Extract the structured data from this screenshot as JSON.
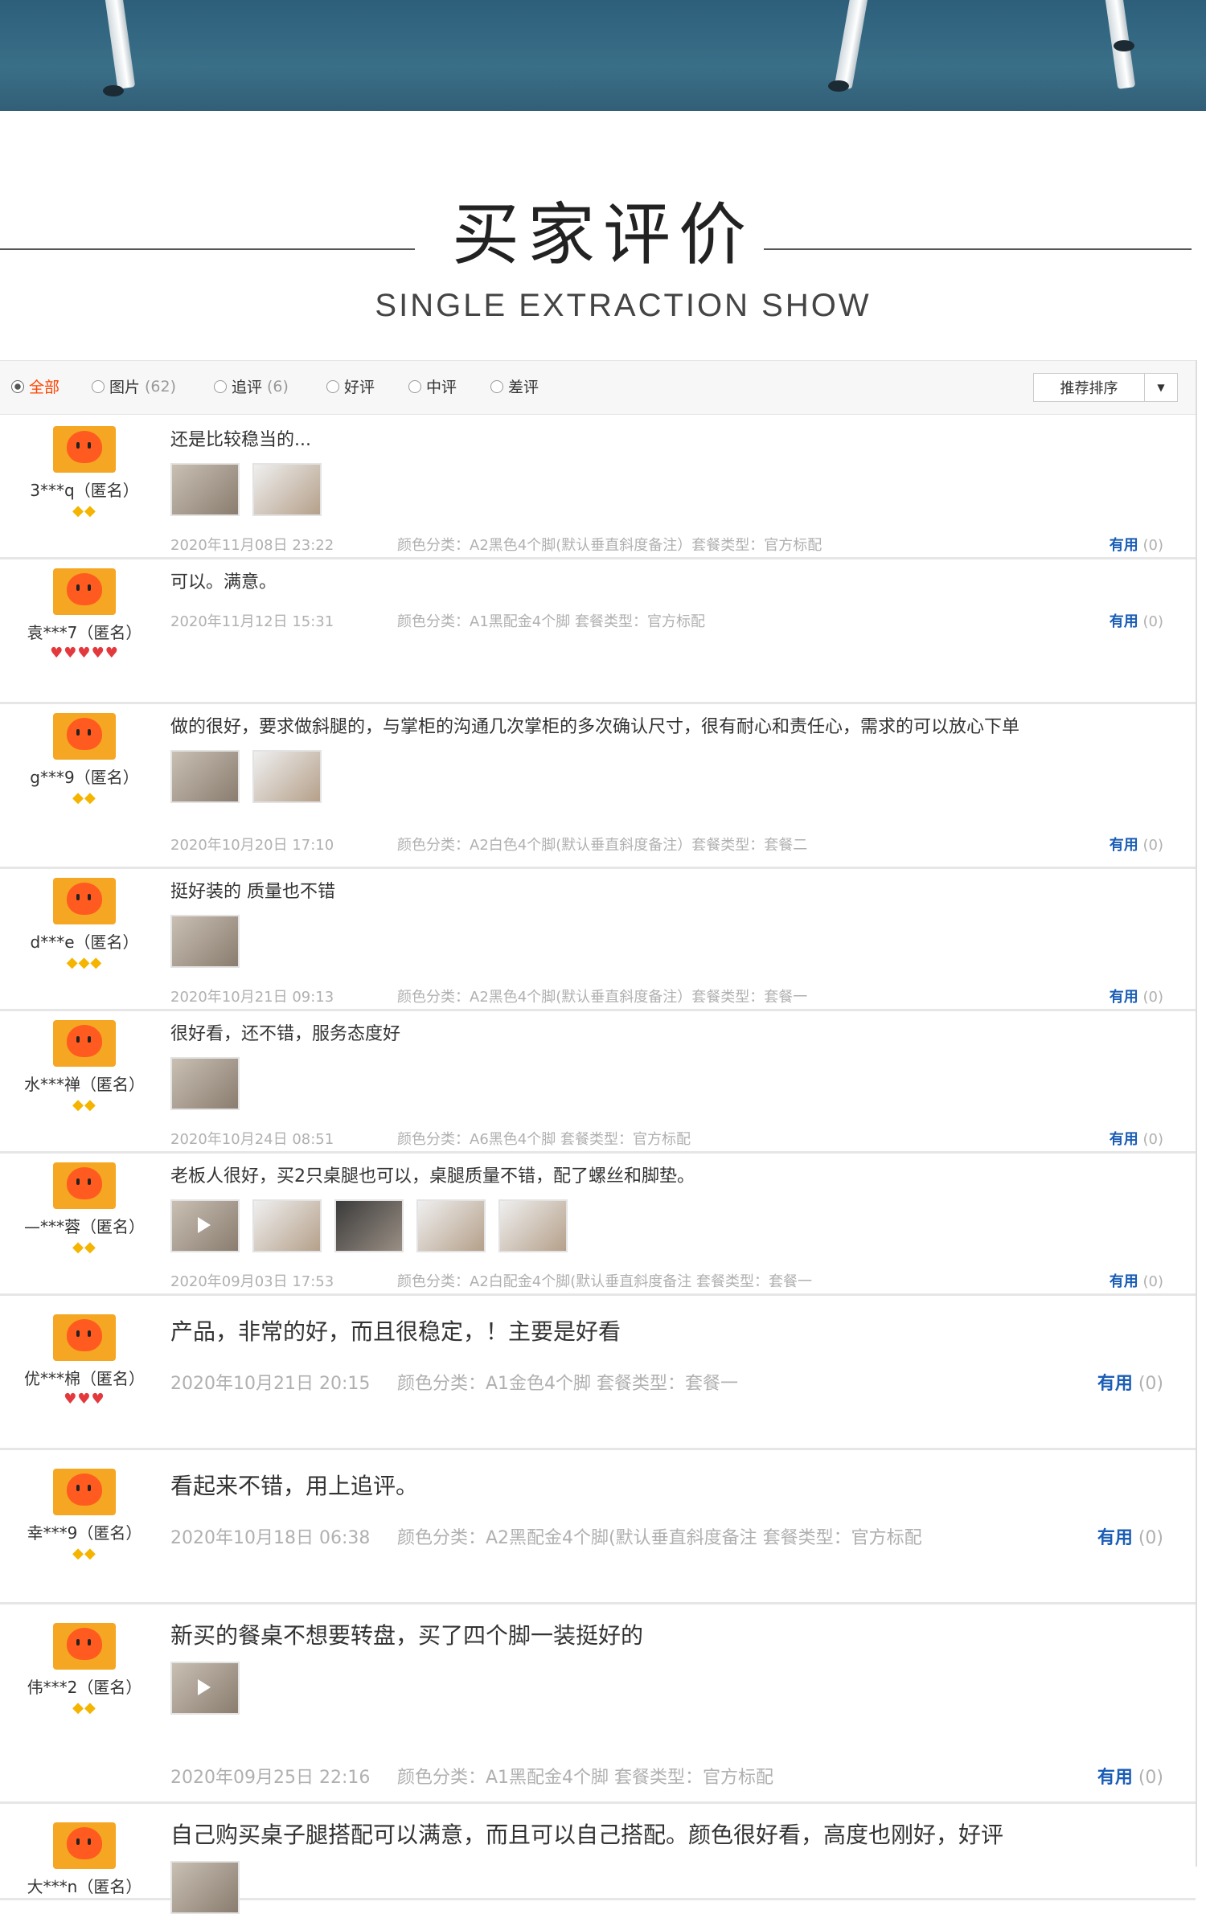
{
  "header": {
    "title_cn": "买家评价",
    "subtitle_en": "SINGLE EXTRACTION SHOW"
  },
  "filters": [
    {
      "label": "全部",
      "count": "",
      "active": true
    },
    {
      "label": "图片",
      "count": "(62)",
      "active": false
    },
    {
      "label": "追评",
      "count": "(6)",
      "active": false
    },
    {
      "label": "好评",
      "count": "",
      "active": false
    },
    {
      "label": "中评",
      "count": "",
      "active": false
    },
    {
      "label": "差评",
      "count": "",
      "active": false
    }
  ],
  "sort": {
    "label": "推荐排序"
  },
  "useful_label": "有用",
  "useful_count": "(0)",
  "reviews": [
    {
      "user": "3***q（匿名）",
      "badge": "◆◆",
      "badge_color": "gold",
      "text": "还是比较稳当的...",
      "thumbs": 2,
      "date": "2020年11月08日 23:22",
      "attr": "颜色分类：A2黑色4个脚(默认垂直斜度备注）套餐类型：官方标配"
    },
    {
      "user": "袁***7（匿名）",
      "badge": "♥♥♥♥♥",
      "badge_color": "red",
      "text": "可以。满意。",
      "thumbs": 0,
      "date": "2020年11月12日 15:31",
      "attr": "颜色分类：A1黑配金4个脚 套餐类型：官方标配"
    },
    {
      "user": "g***9（匿名）",
      "badge": "◆◆",
      "badge_color": "gold",
      "text": "做的很好，要求做斜腿的，与掌柜的沟通几次掌柜的多次确认尺寸，很有耐心和责任心，需求的可以放心下单",
      "thumbs": 2,
      "date": "2020年10月20日 17:10",
      "attr": "颜色分类：A2白色4个脚(默认垂直斜度备注）套餐类型：套餐二"
    },
    {
      "user": "d***e（匿名）",
      "badge": "◆◆◆",
      "badge_color": "gold",
      "text": "挺好装的 质量也不错",
      "thumbs": 1,
      "date": "2020年10月21日 09:13",
      "attr": "颜色分类：A2黑色4个脚(默认垂直斜度备注）套餐类型：套餐一"
    },
    {
      "user": "水***禅（匿名）",
      "badge": "◆◆",
      "badge_color": "gold",
      "text": "很好看，还不错，服务态度好",
      "thumbs": 1,
      "date": "2020年10月24日 08:51",
      "attr": "颜色分类：A6黑色4个脚 套餐类型：官方标配"
    },
    {
      "user": "—***蓉（匿名）",
      "badge": "◆◆",
      "badge_color": "gold",
      "text": "老板人很好，买2只桌腿也可以，桌腿质量不错，配了螺丝和脚垫。",
      "thumbs": 5,
      "date": "2020年09月03日 17:53",
      "attr": "颜色分类：A2白配金4个脚(默认垂直斜度备注 套餐类型：套餐一"
    },
    {
      "user": "优***棉（匿名）",
      "badge": "♥♥♥",
      "badge_color": "red",
      "text": "产品，非常的好，而且很稳定，！主要是好看",
      "thumbs": 0,
      "date": "2020年10月21日 20:15",
      "attr": "颜色分类：A1金色4个脚 套餐类型：套餐一"
    },
    {
      "user": "幸***9（匿名）",
      "badge": "◆◆",
      "badge_color": "gold",
      "text": "看起来不错，用上追评。",
      "thumbs": 0,
      "date": "2020年10月18日 06:38",
      "attr": "颜色分类：A2黑配金4个脚(默认垂直斜度备注 套餐类型：官方标配"
    },
    {
      "user": "伟***2（匿名）",
      "badge": "◆◆",
      "badge_color": "gold",
      "text": "新买的餐桌不想要转盘，买了四个脚一装挺好的",
      "thumbs": 1,
      "date": "2020年09月25日 22:16",
      "attr": "颜色分类：A1黑配金4个脚 套餐类型：官方标配"
    },
    {
      "user": "大***n（匿名）",
      "badge": "",
      "badge_color": "gold",
      "text": "自己购买桌子腿搭配可以满意，而且可以自己搭配。颜色很好看，高度也刚好，好评",
      "thumbs": 1,
      "date": "",
      "attr": ""
    }
  ]
}
